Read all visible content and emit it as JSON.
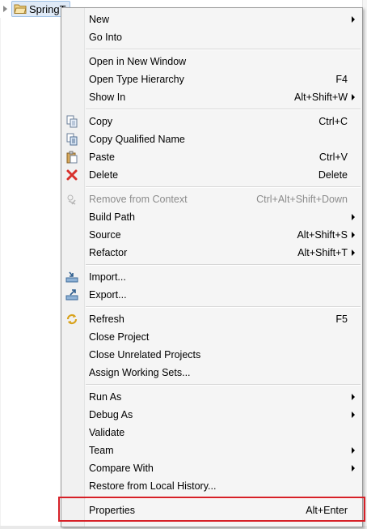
{
  "tree": {
    "node_label": "SpringT"
  },
  "menu": {
    "groups": [
      [
        {
          "label": "New",
          "shortcut": "",
          "submenu": true,
          "icon": "",
          "disabled": false
        },
        {
          "label": "Go Into",
          "shortcut": "",
          "submenu": false,
          "icon": "",
          "disabled": false
        }
      ],
      [
        {
          "label": "Open in New Window",
          "shortcut": "",
          "submenu": false,
          "icon": "",
          "disabled": false
        },
        {
          "label": "Open Type Hierarchy",
          "shortcut": "F4",
          "submenu": false,
          "icon": "",
          "disabled": false
        },
        {
          "label": "Show In",
          "shortcut": "Alt+Shift+W",
          "submenu": true,
          "icon": "",
          "disabled": false
        }
      ],
      [
        {
          "label": "Copy",
          "shortcut": "Ctrl+C",
          "submenu": false,
          "icon": "copy-icon",
          "disabled": false
        },
        {
          "label": "Copy Qualified Name",
          "shortcut": "",
          "submenu": false,
          "icon": "copy-qualified-name-icon",
          "disabled": false
        },
        {
          "label": "Paste",
          "shortcut": "Ctrl+V",
          "submenu": false,
          "icon": "paste-icon",
          "disabled": false
        },
        {
          "label": "Delete",
          "shortcut": "Delete",
          "submenu": false,
          "icon": "delete-icon",
          "disabled": false
        }
      ],
      [
        {
          "label": "Remove from Context",
          "shortcut": "Ctrl+Alt+Shift+Down",
          "submenu": false,
          "icon": "remove-context-icon",
          "disabled": true
        },
        {
          "label": "Build Path",
          "shortcut": "",
          "submenu": true,
          "icon": "",
          "disabled": false
        },
        {
          "label": "Source",
          "shortcut": "Alt+Shift+S",
          "submenu": true,
          "icon": "",
          "disabled": false
        },
        {
          "label": "Refactor",
          "shortcut": "Alt+Shift+T",
          "submenu": true,
          "icon": "",
          "disabled": false
        }
      ],
      [
        {
          "label": "Import...",
          "shortcut": "",
          "submenu": false,
          "icon": "import-icon",
          "disabled": false
        },
        {
          "label": "Export...",
          "shortcut": "",
          "submenu": false,
          "icon": "export-icon",
          "disabled": false
        }
      ],
      [
        {
          "label": "Refresh",
          "shortcut": "F5",
          "submenu": false,
          "icon": "refresh-icon",
          "disabled": false
        },
        {
          "label": "Close Project",
          "shortcut": "",
          "submenu": false,
          "icon": "",
          "disabled": false
        },
        {
          "label": "Close Unrelated Projects",
          "shortcut": "",
          "submenu": false,
          "icon": "",
          "disabled": false
        },
        {
          "label": "Assign Working Sets...",
          "shortcut": "",
          "submenu": false,
          "icon": "",
          "disabled": false
        }
      ],
      [
        {
          "label": "Run As",
          "shortcut": "",
          "submenu": true,
          "icon": "",
          "disabled": false
        },
        {
          "label": "Debug As",
          "shortcut": "",
          "submenu": true,
          "icon": "",
          "disabled": false
        },
        {
          "label": "Validate",
          "shortcut": "",
          "submenu": false,
          "icon": "",
          "disabled": false
        },
        {
          "label": "Team",
          "shortcut": "",
          "submenu": true,
          "icon": "",
          "disabled": false
        },
        {
          "label": "Compare With",
          "shortcut": "",
          "submenu": true,
          "icon": "",
          "disabled": false
        },
        {
          "label": "Restore from Local History...",
          "shortcut": "",
          "submenu": false,
          "icon": "",
          "disabled": false
        }
      ],
      [
        {
          "label": "Properties",
          "shortcut": "Alt+Enter",
          "submenu": false,
          "icon": "",
          "disabled": false
        }
      ]
    ]
  },
  "colors": {
    "highlight_border": "#d62027",
    "menu_bg": "#f5f5f5",
    "disabled_text": "#8c8c8c"
  }
}
